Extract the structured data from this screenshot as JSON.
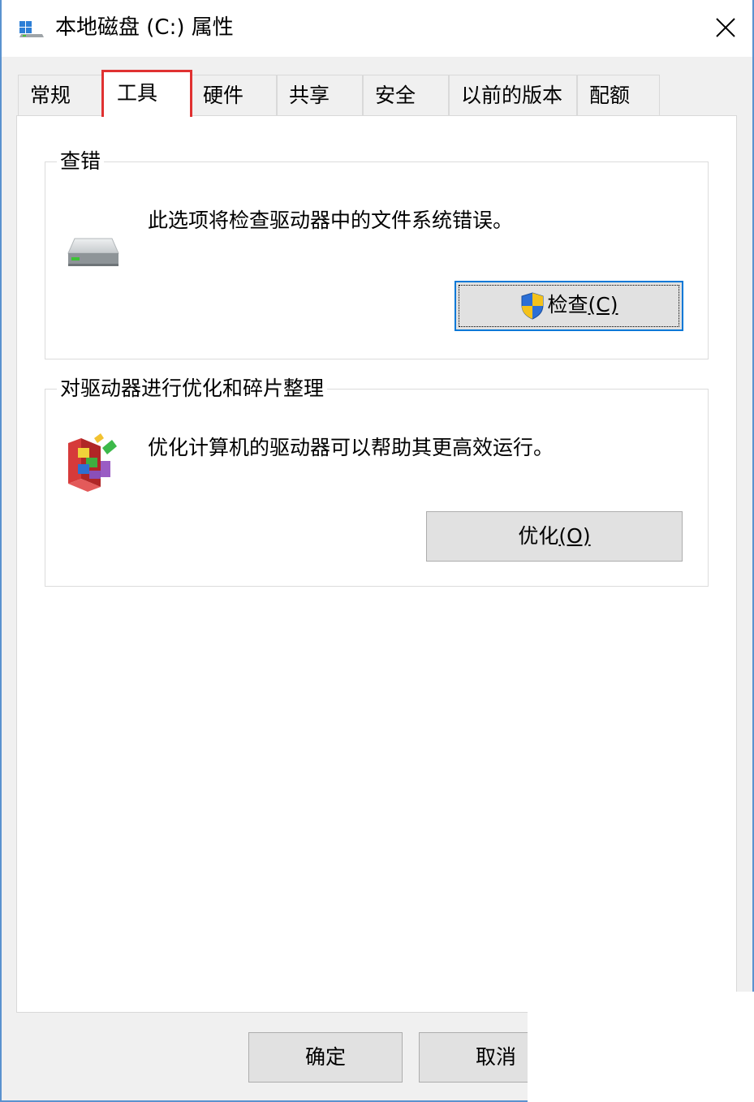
{
  "window": {
    "title": "本地磁盘 (C:) 属性",
    "icon": "drive-icon",
    "close_icon": "close-icon"
  },
  "tabs": [
    {
      "label": "常规",
      "active": false
    },
    {
      "label": "工具",
      "active": true
    },
    {
      "label": "硬件",
      "active": false
    },
    {
      "label": "共享",
      "active": false
    },
    {
      "label": "安全",
      "active": false
    },
    {
      "label": "以前的版本",
      "active": false
    },
    {
      "label": "配额",
      "active": false
    }
  ],
  "error_check": {
    "title": "查错",
    "icon": "hard-drive-icon",
    "description": "此选项将检查驱动器中的文件系统错误。",
    "button": {
      "text": "检查",
      "accel": "(C)",
      "icon": "uac-shield-icon"
    }
  },
  "optimize": {
    "title": "对驱动器进行优化和碎片整理",
    "icon": "defrag-icon",
    "description": "优化计算机的驱动器可以帮助其更高效运行。",
    "button": {
      "text": "优化",
      "accel": "(O)"
    }
  },
  "footer": {
    "ok_label": "确定",
    "cancel_label": "取消"
  },
  "colors": {
    "window_border": "#5a92cf",
    "highlight_box": "#e03131",
    "default_button_border": "#0078d7",
    "button_face": "#e1e1e1"
  }
}
